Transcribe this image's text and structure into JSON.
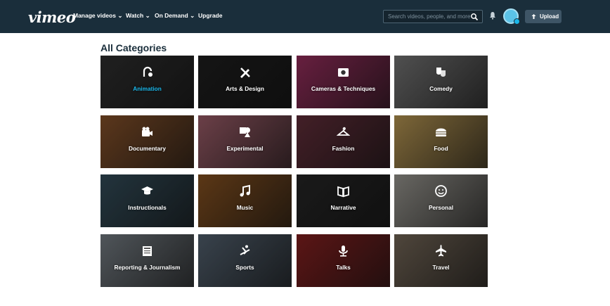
{
  "nav": {
    "logo": "vimeo",
    "links": [
      "Manage videos",
      "Watch",
      "On Demand",
      "Upgrade"
    ],
    "search_placeholder": "Search videos, people, and more",
    "upload_label": "Upload"
  },
  "page": {
    "heading": "All Categories"
  },
  "categories": [
    {
      "label": "Animation",
      "icon": "animation-icon",
      "color": "#2b2b2b",
      "active": true
    },
    {
      "label": "Arts & Design",
      "icon": "brush-pencil-icon",
      "color": "#1c1c1c",
      "active": false
    },
    {
      "label": "Cameras & Techniques",
      "icon": "camera-icon",
      "color": "#8a2a55",
      "active": false
    },
    {
      "label": "Comedy",
      "icon": "theater-masks-icon",
      "color": "#6b6b6b",
      "active": false
    },
    {
      "label": "Documentary",
      "icon": "video-camera-icon",
      "color": "#7a4a26",
      "active": false
    },
    {
      "label": "Experimental",
      "icon": "shapes-icon",
      "color": "#8f5560",
      "active": false
    },
    {
      "label": "Fashion",
      "icon": "hanger-icon",
      "color": "#5a2a35",
      "active": false
    },
    {
      "label": "Food",
      "icon": "burger-icon",
      "color": "#a88a4c",
      "active": false
    },
    {
      "label": "Instructionals",
      "icon": "graduation-cap-icon",
      "color": "#2f4652",
      "active": false
    },
    {
      "label": "Music",
      "icon": "music-note-icon",
      "color": "#7a4a1d",
      "active": false
    },
    {
      "label": "Narrative",
      "icon": "book-icon",
      "color": "#232323",
      "active": false
    },
    {
      "label": "Personal",
      "icon": "smiley-icon",
      "color": "#8c8a84",
      "active": false
    },
    {
      "label": "Reporting & Journalism",
      "icon": "newspaper-icon",
      "color": "#6b7278",
      "active": false
    },
    {
      "label": "Sports",
      "icon": "ski-icon",
      "color": "#4c5966",
      "active": false
    },
    {
      "label": "Talks",
      "icon": "microphone-icon",
      "color": "#7a1d1d",
      "active": false
    },
    {
      "label": "Travel",
      "icon": "airplane-icon",
      "color": "#6a5e50",
      "active": false
    }
  ]
}
